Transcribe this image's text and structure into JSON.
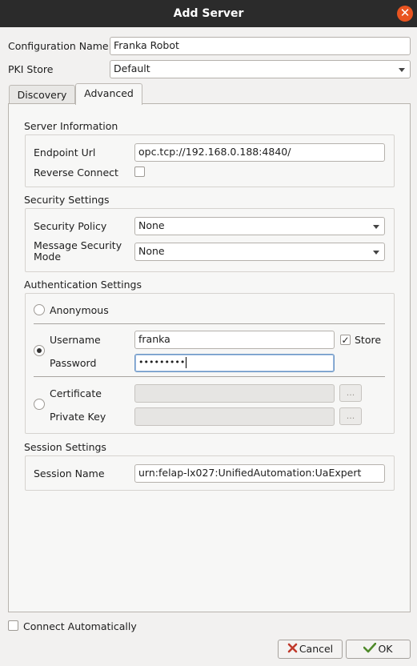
{
  "window": {
    "title": "Add Server",
    "close_glyph": "✕"
  },
  "config": {
    "name_label": "Configuration Name",
    "name_value": "Franka Robot",
    "pki_label": "PKI Store",
    "pki_value": "Default"
  },
  "tabs": [
    {
      "label": "Discovery",
      "active": false
    },
    {
      "label": "Advanced",
      "active": true
    }
  ],
  "server_info": {
    "heading": "Server Information",
    "endpoint_label": "Endpoint Url",
    "endpoint_value": "opc.tcp://192.168.0.188:4840/",
    "reverse_label": "Reverse Connect",
    "reverse_checked": false
  },
  "security": {
    "heading": "Security Settings",
    "policy_label": "Security Policy",
    "policy_value": "None",
    "mode_label": "Message Security Mode",
    "mode_value": "None"
  },
  "auth": {
    "heading": "Authentication Settings",
    "anonymous_label": "Anonymous",
    "username_label": "Username",
    "username_value": "franka",
    "store_label": "Store",
    "store_checked": true,
    "password_label": "Password",
    "password_mask": "•••••••••",
    "certificate_label": "Certificate",
    "private_key_label": "Private Key",
    "browse_label": "...",
    "selected": "username"
  },
  "session": {
    "heading": "Session Settings",
    "name_label": "Session Name",
    "name_value": "urn:felap-lx027:UnifiedAutomation:UaExpert"
  },
  "footer": {
    "connect_auto_label": "Connect Automatically",
    "connect_auto_checked": false,
    "cancel_label": "Cancel",
    "ok_label": "OK"
  },
  "colors": {
    "titlebar": "#2b2b2b",
    "close": "#e95420",
    "background": "#f2f1f0"
  }
}
